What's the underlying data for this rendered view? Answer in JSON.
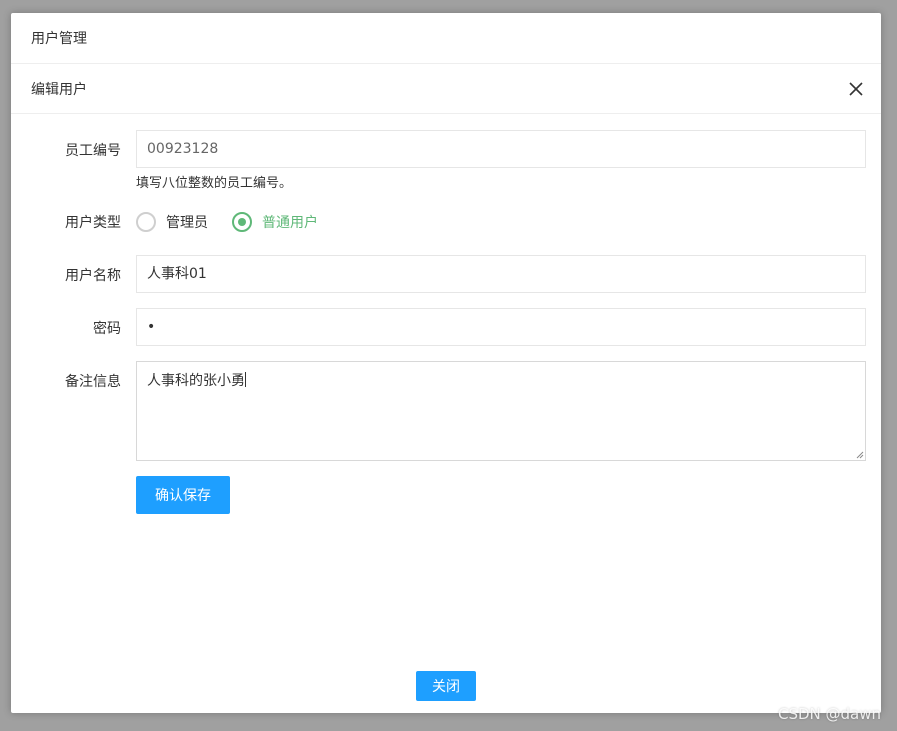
{
  "outer_dialog": {
    "title": "用户管理"
  },
  "edit_dialog": {
    "title": "编辑用户",
    "close_icon": "close-icon",
    "fields": {
      "employee_no": {
        "label": "员工编号",
        "value": "00923128",
        "hint": "填写八位整数的员工编号。"
      },
      "user_type": {
        "label": "用户类型",
        "options": [
          "管理员",
          "普通用户"
        ],
        "selected": "普通用户"
      },
      "username": {
        "label": "用户名称",
        "value": "人事科01"
      },
      "password": {
        "label": "密码",
        "value": "•"
      },
      "remark": {
        "label": "备注信息",
        "value": "人事科的张小勇"
      }
    },
    "save_label": "确认保存"
  },
  "footer": {
    "close_label": "关闭"
  },
  "watermark": "CSDN @dawn",
  "colors": {
    "primary": "#1E9FFF",
    "radio_checked": "#5FB878",
    "border": "#e6e6e6"
  }
}
